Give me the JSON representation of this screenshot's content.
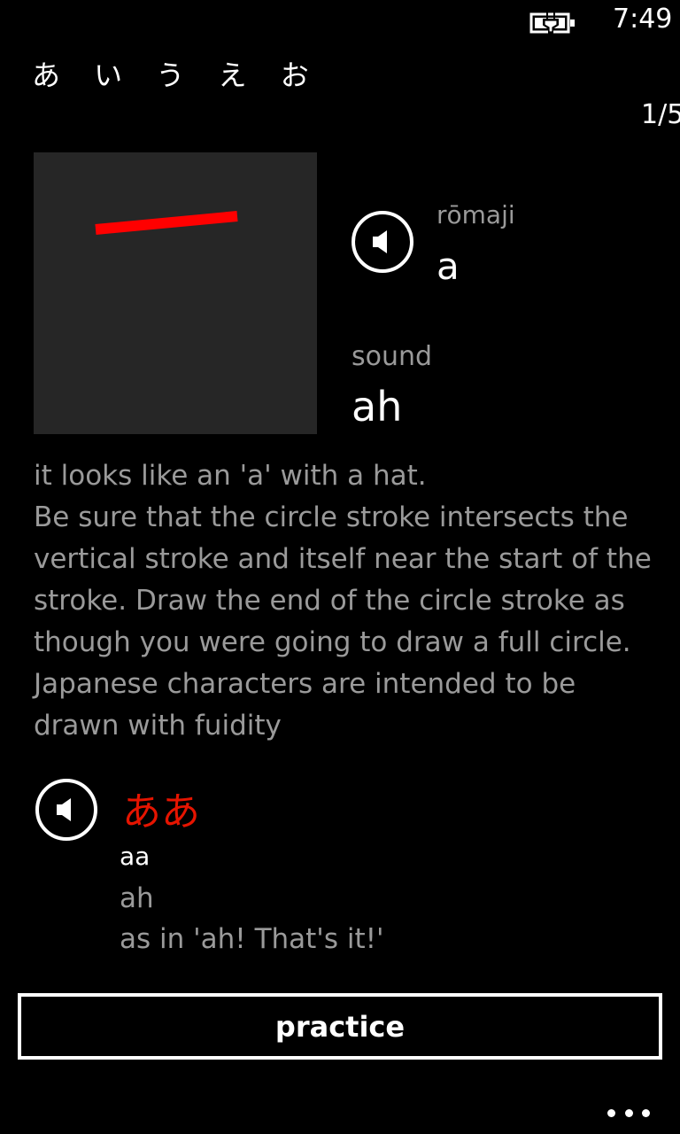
{
  "status_bar": {
    "time": "7:49",
    "battery_icon": "battery-charging-icon"
  },
  "header": {
    "title": "あ い う え お",
    "page_counter": "1/5"
  },
  "character": {
    "stroke_canvas_icon": "stroke-order-canvas",
    "romaji_label": "rōmaji",
    "romaji_value": "a",
    "sound_label": "sound",
    "sound_value": "ah",
    "speaker_icon": "speaker-icon"
  },
  "description": {
    "lines": [
      "it looks like an 'a' with a hat.",
      "Be sure that the circle stroke intersects the",
      "vertical stroke and itself near the start of the",
      "stroke. Draw the end of the circle stroke as",
      "though you were going to draw a full circle.",
      "Japanese characters are intended to be",
      "drawn with fuidity"
    ]
  },
  "example": {
    "kana": "ああ",
    "romaji": "aa",
    "sound": "ah",
    "note": "as in 'ah! That's it!'"
  },
  "actions": {
    "practice_label": "practice",
    "more_icon": "more-dots-icon"
  },
  "colors": {
    "background": "#000000",
    "accent_red": "#e51400",
    "stroke_red": "#ff0000",
    "secondary_text": "#9a9a9a",
    "canvas_bg": "#262626"
  }
}
